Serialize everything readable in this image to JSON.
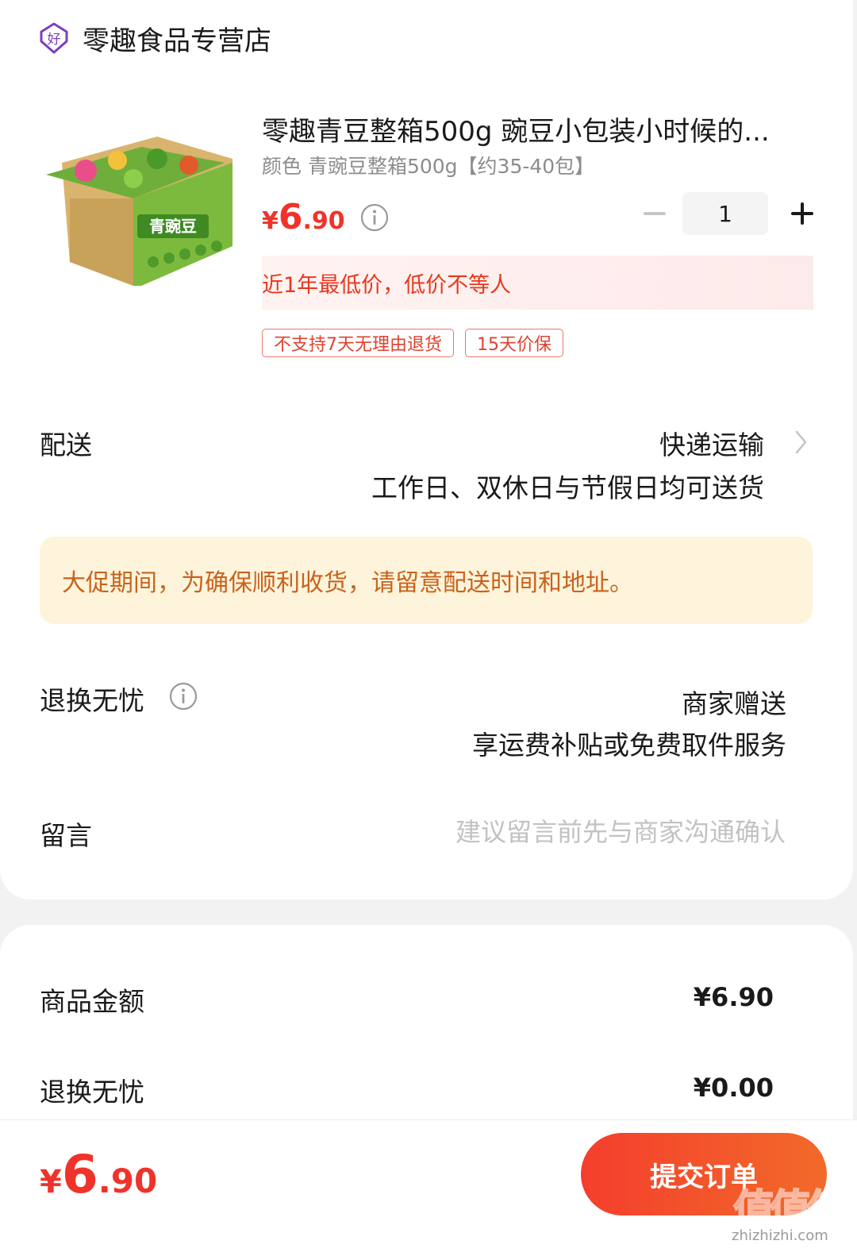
{
  "store": {
    "name": "零趣食品专营店",
    "badge_icon": "good-store-badge-icon",
    "badge_char": "好",
    "badge_color": "#7a3fc2"
  },
  "product": {
    "image_icon": "product-box-green-peas-image",
    "image_text": "青豌豆",
    "title": "零趣青豆整箱500g 豌豆小包装小时候的...",
    "spec": "颜色 青豌豆整箱500g【约35-40包】",
    "price": {
      "currency": "¥",
      "integer": "6",
      "decimal": ".90"
    },
    "quantity": "1",
    "promo": "近1年最低价，低价不等人",
    "tags": [
      "不支持7天无理由退货",
      "15天价保"
    ]
  },
  "delivery": {
    "label": "配送",
    "method": "快递运输",
    "schedule": "工作日、双休日与节假日均可送货"
  },
  "notice": "大促期间，为确保顺利收货，请留意配送时间和地址。",
  "return_service": {
    "label": "退换无忧",
    "value": "商家赠送",
    "sub": "享运费补贴或免费取件服务"
  },
  "message": {
    "label": "留言",
    "placeholder": "建议留言前先与商家沟通确认"
  },
  "summary": [
    {
      "label": "商品金额",
      "value": "¥6.90"
    },
    {
      "label": "退换无忧",
      "value": "¥0.00"
    }
  ],
  "footer": {
    "total": {
      "currency": "¥",
      "integer": "6",
      "decimal": ".90"
    },
    "submit_label": "提交订单",
    "watermark": "值",
    "watermark_text": "zhizhizhi.com"
  },
  "colors": {
    "accent_red": "#f0332a",
    "notice_bg": "#fdf4db",
    "notice_text": "#c9621e"
  }
}
